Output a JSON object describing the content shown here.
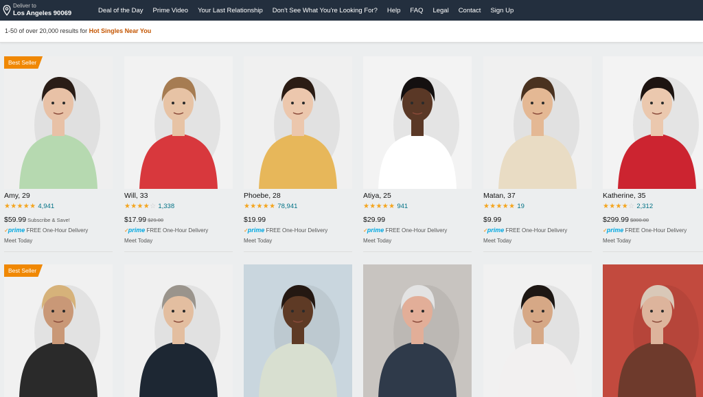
{
  "deliver": {
    "label": "Deliver to",
    "location": "Los Angeles 90069"
  },
  "nav": {
    "items": [
      "Deal of the Day",
      "Prime Video",
      "Your Last Relationship",
      "Don't See What You're Looking For?",
      "Help",
      "FAQ",
      "Legal",
      "Contact",
      "Sign Up"
    ]
  },
  "results": {
    "prefix": "1-50 of over 20,000 results for ",
    "query": "Hot Singles Near You"
  },
  "common": {
    "prime": "prime",
    "delivery": "FREE One-Hour Delivery",
    "meet": "Meet Today",
    "best_seller": "Best Seller",
    "subscribe": "Subscribe & Save!"
  },
  "products": [
    {
      "name": "Amy, 29",
      "stars": 4.5,
      "reviews": "4,941",
      "price": "$59.99",
      "old_price": "",
      "subscribe": true,
      "best_seller": true,
      "bg": "#efefef",
      "shirt": "#b6d9b0",
      "hair": "#2a1d17",
      "skin": "#e8c1a6",
      "pants": "#5a7fa8"
    },
    {
      "name": "Will, 33",
      "stars": 3.5,
      "reviews": "1,338",
      "price": "$17.99",
      "old_price": "$29.00",
      "subscribe": false,
      "best_seller": false,
      "bg": "#f2f2f2",
      "shirt": "#d8383d",
      "hair": "#a67c52",
      "skin": "#e7c3a5",
      "pants": "#5b7ea4"
    },
    {
      "name": "Phoebe, 28",
      "stars": 4.5,
      "reviews": "78,941",
      "price": "$19.99",
      "old_price": "",
      "subscribe": false,
      "best_seller": false,
      "bg": "#f0f0f0",
      "shirt": "#e7b75a",
      "hair": "#2b1c14",
      "skin": "#ecc7ad",
      "pants": "#1e1e1e"
    },
    {
      "name": "Atiya, 25",
      "stars": 4.5,
      "reviews": "941",
      "price": "$29.99",
      "old_price": "",
      "subscribe": false,
      "best_seller": false,
      "bg": "#f3f3f3",
      "shirt": "#ffffff",
      "hair": "#141010",
      "skin": "#5a3826",
      "pants": "#e4e4e4"
    },
    {
      "name": "Matan, 37",
      "stars": 4.5,
      "reviews": "19",
      "price": "$9.99",
      "old_price": "",
      "subscribe": false,
      "best_seller": false,
      "bg": "#f0f0f0",
      "shirt": "#e9dcc4",
      "hair": "#4a3220",
      "skin": "#e4b894",
      "pants": "#3c3c3c"
    },
    {
      "name": "Katherine, 35",
      "stars": 3.5,
      "reviews": "2,312",
      "price": "$299.99",
      "old_price": "$800.00",
      "subscribe": false,
      "best_seller": false,
      "bg": "#f3f3f3",
      "shirt": "#cc2430",
      "hair": "#1d1411",
      "skin": "#ebc8ae",
      "pants": "#3f5f86"
    },
    {
      "name": "",
      "stars": 0,
      "reviews": "",
      "price": "",
      "old_price": "",
      "subscribe": false,
      "best_seller": true,
      "bg": "#f1f1f1",
      "shirt": "#2a2a2a",
      "hair": "#d6b27a",
      "skin": "#c99877",
      "pants": "#333"
    },
    {
      "name": "",
      "stars": 0,
      "reviews": "",
      "price": "",
      "old_price": "",
      "subscribe": false,
      "best_seller": false,
      "bg": "#f0f0f0",
      "shirt": "#1d2733",
      "hair": "#9a948c",
      "skin": "#e3bea0",
      "pants": "#333"
    },
    {
      "name": "",
      "stars": 0,
      "reviews": "",
      "price": "",
      "old_price": "",
      "subscribe": false,
      "best_seller": false,
      "bg": "#c9d6de",
      "shirt": "#d8dfd0",
      "hair": "#241812",
      "skin": "#5e3a25",
      "pants": "#333"
    },
    {
      "name": "",
      "stars": 0,
      "reviews": "",
      "price": "",
      "old_price": "",
      "subscribe": false,
      "best_seller": false,
      "bg": "#c8c4c0",
      "shirt": "#2f3a4a",
      "hair": "#e3e3e3",
      "skin": "#e2ae98",
      "pants": "#333"
    },
    {
      "name": "",
      "stars": 0,
      "reviews": "",
      "price": "",
      "old_price": "",
      "subscribe": false,
      "best_seller": false,
      "bg": "#f1f1f1",
      "shirt": "#f2f0f0",
      "hair": "#1d1714",
      "skin": "#d6a886",
      "pants": "#333"
    },
    {
      "name": "",
      "stars": 0,
      "reviews": "",
      "price": "",
      "old_price": "",
      "subscribe": false,
      "best_seller": false,
      "bg": "#c24a3e",
      "shirt": "#6e3a2c",
      "hair": "#d9c8b8",
      "skin": "#ddb49c",
      "pants": "#333"
    }
  ]
}
